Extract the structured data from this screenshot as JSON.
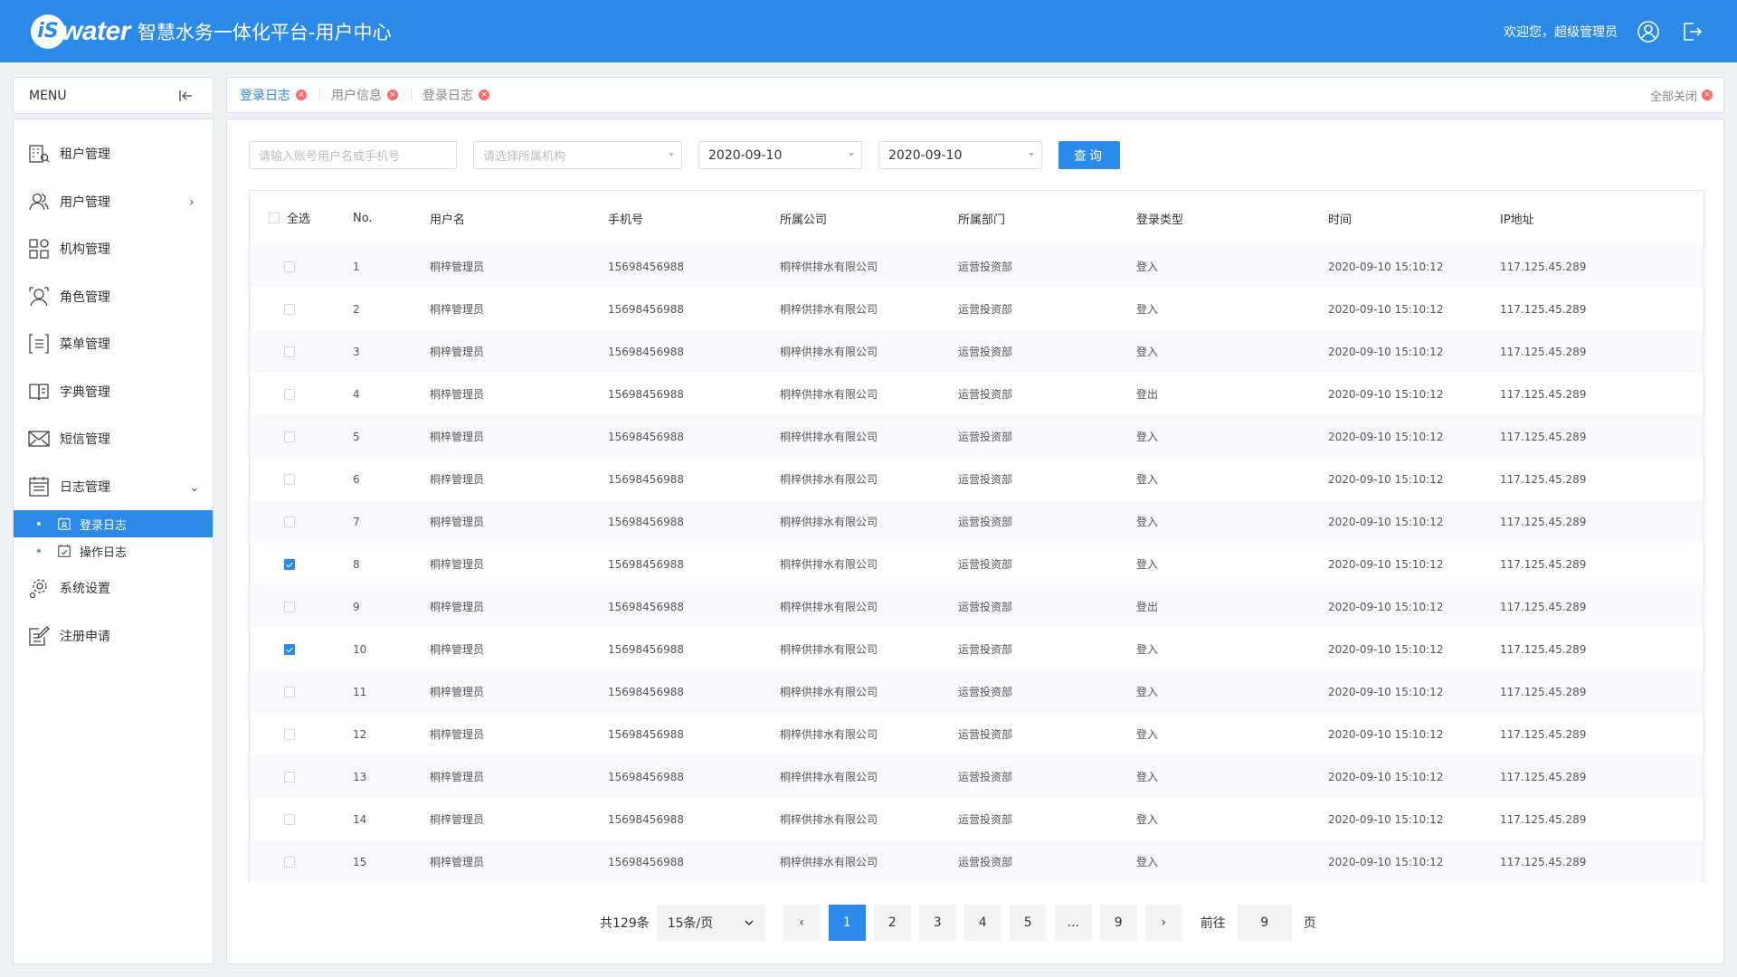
{
  "header": {
    "logo_mark": "iS",
    "logo_word": "water",
    "title": "智慧水务一体化平台-用户中心",
    "welcome": "欢迎您，超级管理员",
    "icons": [
      "user-circle-icon",
      "logout-icon"
    ],
    "bg_color": "#2b89e8"
  },
  "sidebar": {
    "menu_label": "MENU",
    "items": [
      {
        "label": "租户管理",
        "icon": "tenant-icon"
      },
      {
        "label": "用户管理",
        "icon": "users-icon",
        "arrow": "›"
      },
      {
        "label": "机构管理",
        "icon": "org-icon"
      },
      {
        "label": "角色管理",
        "icon": "role-icon"
      },
      {
        "label": "菜单管理",
        "icon": "menu-list-icon"
      },
      {
        "label": "字典管理",
        "icon": "dictionary-icon"
      },
      {
        "label": "短信管理",
        "icon": "sms-icon"
      },
      {
        "label": "日志管理",
        "icon": "log-icon",
        "arrow": "⌄"
      },
      {
        "label": "系统设置",
        "icon": "settings-icon"
      },
      {
        "label": "注册申请",
        "icon": "register-icon"
      }
    ],
    "sub_items": [
      {
        "label": "登录日志",
        "active": true
      },
      {
        "label": "操作日志",
        "active": false
      }
    ]
  },
  "tabs": {
    "items": [
      {
        "label": "登录日志",
        "active": true
      },
      {
        "label": "用户信息",
        "active": false
      },
      {
        "label": "登录日志",
        "active": false
      }
    ],
    "close_all": "全部关闭",
    "close_glyph": "×"
  },
  "filters": {
    "account_placeholder": "请输入账号用户名或手机号",
    "org_placeholder": "请选择所属机构",
    "date_start": "2020-09-10",
    "date_end": "2020-09-10",
    "search_label": "查询"
  },
  "table": {
    "select_all_label": "全选",
    "columns": [
      "No.",
      "用户名",
      "手机号",
      "所属公司",
      "所属部门",
      "登录类型",
      "时间",
      "IP地址"
    ],
    "rows": [
      {
        "no": "1",
        "user": "桐梓管理员",
        "phone": "15698456988",
        "company": "桐梓供排水有限公司",
        "dept": "运营投资部",
        "type": "登入",
        "time": "2020-09-10 15:10:12",
        "ip": "117.125.45.289",
        "checked": false
      },
      {
        "no": "2",
        "user": "桐梓管理员",
        "phone": "15698456988",
        "company": "桐梓供排水有限公司",
        "dept": "运营投资部",
        "type": "登入",
        "time": "2020-09-10 15:10:12",
        "ip": "117.125.45.289",
        "checked": false
      },
      {
        "no": "3",
        "user": "桐梓管理员",
        "phone": "15698456988",
        "company": "桐梓供排水有限公司",
        "dept": "运营投资部",
        "type": "登入",
        "time": "2020-09-10 15:10:12",
        "ip": "117.125.45.289",
        "checked": false
      },
      {
        "no": "4",
        "user": "桐梓管理员",
        "phone": "15698456988",
        "company": "桐梓供排水有限公司",
        "dept": "运营投资部",
        "type": "登出",
        "time": "2020-09-10 15:10:12",
        "ip": "117.125.45.289",
        "checked": false
      },
      {
        "no": "5",
        "user": "桐梓管理员",
        "phone": "15698456988",
        "company": "桐梓供排水有限公司",
        "dept": "运营投资部",
        "type": "登入",
        "time": "2020-09-10 15:10:12",
        "ip": "117.125.45.289",
        "checked": false
      },
      {
        "no": "6",
        "user": "桐梓管理员",
        "phone": "15698456988",
        "company": "桐梓供排水有限公司",
        "dept": "运营投资部",
        "type": "登入",
        "time": "2020-09-10 15:10:12",
        "ip": "117.125.45.289",
        "checked": false
      },
      {
        "no": "7",
        "user": "桐梓管理员",
        "phone": "15698456988",
        "company": "桐梓供排水有限公司",
        "dept": "运营投资部",
        "type": "登入",
        "time": "2020-09-10 15:10:12",
        "ip": "117.125.45.289",
        "checked": false
      },
      {
        "no": "8",
        "user": "桐梓管理员",
        "phone": "15698456988",
        "company": "桐梓供排水有限公司",
        "dept": "运营投资部",
        "type": "登入",
        "time": "2020-09-10 15:10:12",
        "ip": "117.125.45.289",
        "checked": true
      },
      {
        "no": "9",
        "user": "桐梓管理员",
        "phone": "15698456988",
        "company": "桐梓供排水有限公司",
        "dept": "运营投资部",
        "type": "登出",
        "time": "2020-09-10 15:10:12",
        "ip": "117.125.45.289",
        "checked": false
      },
      {
        "no": "10",
        "user": "桐梓管理员",
        "phone": "15698456988",
        "company": "桐梓供排水有限公司",
        "dept": "运营投资部",
        "type": "登入",
        "time": "2020-09-10 15:10:12",
        "ip": "117.125.45.289",
        "checked": true
      },
      {
        "no": "11",
        "user": "桐梓管理员",
        "phone": "15698456988",
        "company": "桐梓供排水有限公司",
        "dept": "运营投资部",
        "type": "登入",
        "time": "2020-09-10 15:10:12",
        "ip": "117.125.45.289",
        "checked": false
      },
      {
        "no": "12",
        "user": "桐梓管理员",
        "phone": "15698456988",
        "company": "桐梓供排水有限公司",
        "dept": "运营投资部",
        "type": "登入",
        "time": "2020-09-10 15:10:12",
        "ip": "117.125.45.289",
        "checked": false
      },
      {
        "no": "13",
        "user": "桐梓管理员",
        "phone": "15698456988",
        "company": "桐梓供排水有限公司",
        "dept": "运营投资部",
        "type": "登入",
        "time": "2020-09-10 15:10:12",
        "ip": "117.125.45.289",
        "checked": false
      },
      {
        "no": "14",
        "user": "桐梓管理员",
        "phone": "15698456988",
        "company": "桐梓供排水有限公司",
        "dept": "运营投资部",
        "type": "登入",
        "time": "2020-09-10 15:10:12",
        "ip": "117.125.45.289",
        "checked": false
      },
      {
        "no": "15",
        "user": "桐梓管理员",
        "phone": "15698456988",
        "company": "桐梓供排水有限公司",
        "dept": "运营投资部",
        "type": "登入",
        "time": "2020-09-10 15:10:12",
        "ip": "117.125.45.289",
        "checked": false
      }
    ]
  },
  "pagination": {
    "total_text": "共129条",
    "page_size": "15条/页",
    "prev": "‹",
    "next": "›",
    "pages": [
      "1",
      "2",
      "3",
      "4",
      "5",
      "...",
      "9"
    ],
    "current_page": "1",
    "goto_label": "前往",
    "goto_value": "9",
    "page_suffix": "页"
  }
}
